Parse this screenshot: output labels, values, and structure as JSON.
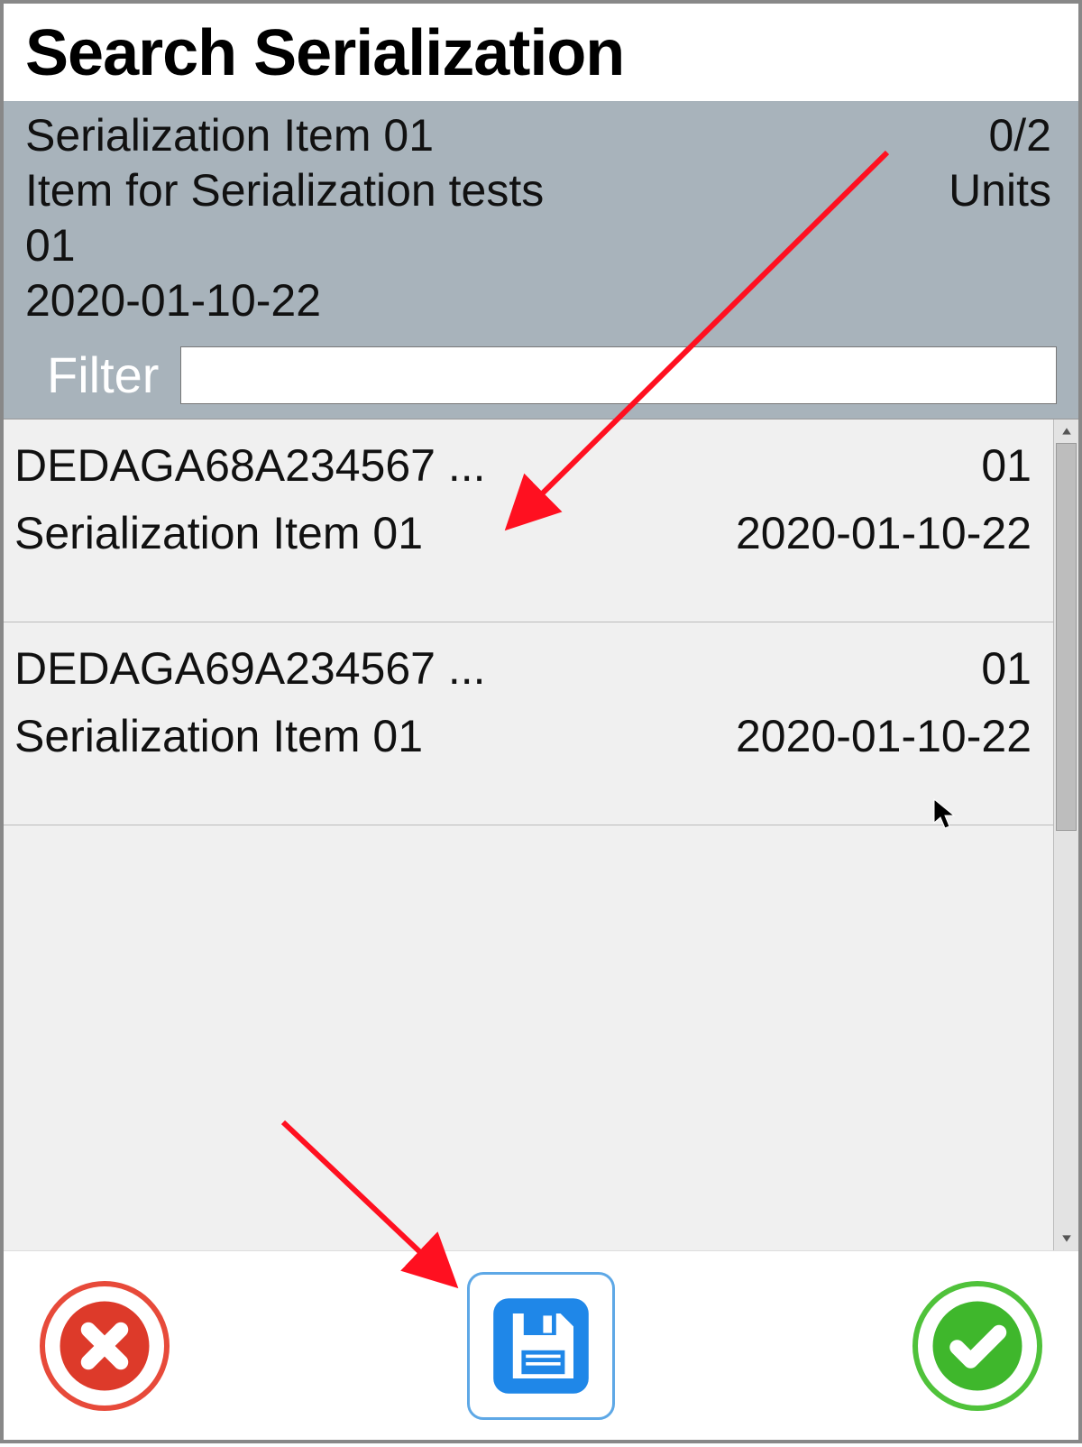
{
  "title": "Search Serialization",
  "info": {
    "line1_left": "Serialization Item 01",
    "line1_right": "0/2",
    "line2_left": "Item for Serialization tests",
    "line2_right": "Units",
    "line3": "01",
    "line4": "2020-01-10-22"
  },
  "filter": {
    "label": "Filter",
    "value": ""
  },
  "results": [
    {
      "serial": "DEDAGA68A234567 ...",
      "qty": "01",
      "item_name": "Serialization Item 01",
      "date": "2020-01-10-22"
    },
    {
      "serial": "DEDAGA69A234567 ...",
      "qty": "01",
      "item_name": "Serialization Item 01",
      "date": "2020-01-10-22"
    }
  ],
  "buttons": {
    "cancel": "cancel",
    "save": "save",
    "confirm": "confirm"
  }
}
